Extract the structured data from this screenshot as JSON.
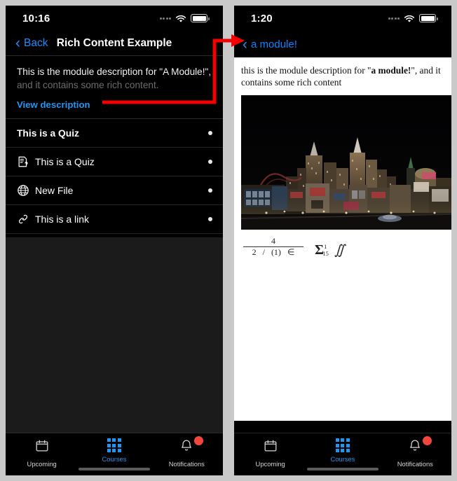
{
  "left_phone": {
    "status": {
      "time": "10:16",
      "signal_icon": "signal-dots-icon",
      "wifi_icon": "wifi-icon",
      "battery_icon": "battery-icon"
    },
    "nav": {
      "back_label": "Back",
      "back_icon": "chevron-left-icon",
      "title": "Rich Content Example"
    },
    "description": {
      "line1": "This is the module description for \"A Module!\",",
      "line2": "and it contains some rich content.",
      "view_link": "View description"
    },
    "list": [
      {
        "label": "This is a Quiz",
        "icon": "",
        "header": true
      },
      {
        "label": "This is a Quiz",
        "icon": "quiz-icon",
        "header": false
      },
      {
        "label": "New File",
        "icon": "globe-icon",
        "header": false
      },
      {
        "label": "This is a link",
        "icon": "link-icon",
        "header": false
      }
    ],
    "tabs": [
      {
        "label": "Upcoming",
        "icon": "calendar-icon",
        "active": false,
        "badge": false
      },
      {
        "label": "Courses",
        "icon": "grid-icon",
        "active": true,
        "badge": false
      },
      {
        "label": "Notifications",
        "icon": "bell-icon",
        "active": false,
        "badge": true
      }
    ]
  },
  "right_phone": {
    "status": {
      "time": "1:20",
      "signal_icon": "signal-dots-icon",
      "wifi_icon": "wifi-icon",
      "battery_icon": "battery-icon"
    },
    "nav": {
      "back_label": "a module!",
      "back_icon": "chevron-left-icon"
    },
    "content": {
      "text_before": "this is the module description for \"",
      "text_bold": "a module!",
      "text_after": "\", and it contains some rich content",
      "image_alt": "las-vegas-night-skyline-photo",
      "math": {
        "numerator": "4",
        "denominator_parts": [
          "2",
          "/",
          "(1)",
          "∈"
        ],
        "sigma": "Σ",
        "sigma_sup": "1",
        "sigma_sub": "15",
        "double_integral": "∬"
      }
    },
    "tabs": [
      {
        "label": "Upcoming",
        "icon": "calendar-icon",
        "active": false,
        "badge": false
      },
      {
        "label": "Courses",
        "icon": "grid-icon",
        "active": true,
        "badge": false
      },
      {
        "label": "Notifications",
        "icon": "bell-icon",
        "active": false,
        "badge": true
      }
    ]
  },
  "annotation": {
    "color": "#f40000",
    "type": "arrow-callout",
    "from": "view-description-link",
    "to": "right-phone-back-button"
  },
  "colors": {
    "accent_blue": "#2196f3",
    "ios_blue": "#0a84ff",
    "badge_red": "#f4463c",
    "panel_bg": "#000000",
    "page_bg": "#c9c9c9"
  }
}
